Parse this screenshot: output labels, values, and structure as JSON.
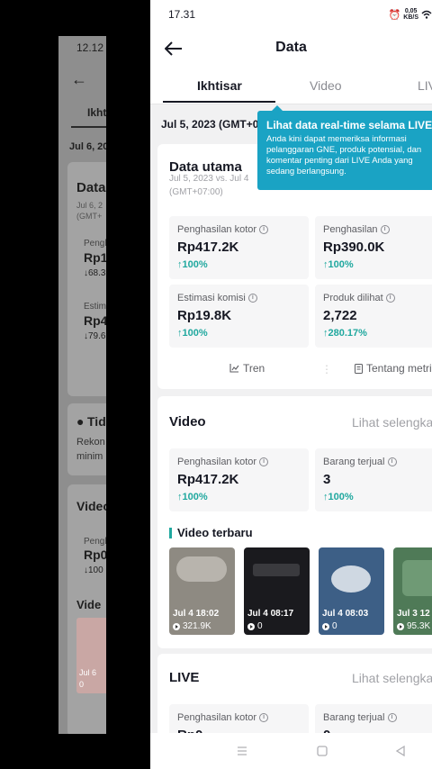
{
  "background_screen": {
    "time": "12.12",
    "tab": "Ikht",
    "date": "Jul 6, 20",
    "card_title": "Data",
    "card_sub_1": "Jul 6, 2",
    "card_sub_2": "(GMT+",
    "metric1_label": "Pengh",
    "metric1_value": "Rp1",
    "metric1_change": "↓68.3",
    "metric2_label": "Estim",
    "metric2_value": "Rp4",
    "metric2_change": "↓79.6",
    "tips_title": "Tid",
    "tips_line1": "Rekon",
    "tips_line2": "minim",
    "video_title": "Video",
    "video_metric_label": "Pengh",
    "video_metric_value": "Rp0",
    "video_metric_change": "↓100",
    "latest_label": "Vide",
    "thumb_text": "Jul 6",
    "thumb_views": "0"
  },
  "status_bar": {
    "time": "17.31",
    "speed_top": "0,05",
    "speed_bottom": "KB/S"
  },
  "header": {
    "title": "Data"
  },
  "tabs": [
    {
      "label": "Ikhtisar",
      "active": true
    },
    {
      "label": "Video",
      "active": false
    },
    {
      "label": "LIVE",
      "active": false
    }
  ],
  "date_range": "Jul 5, 2023 (GMT+0",
  "tooltip": {
    "title": "Lihat data real-time selama LIVE",
    "lines": [
      "Anda kini dapat memeriksa informasi",
      "pelanggaran GNE, produk potensial, dan",
      "komentar penting dari LIVE Anda yang",
      "sedang berlangsung."
    ]
  },
  "main_data": {
    "title": "Data utama",
    "comparison_line1": "Jul 5, 2023 vs. Jul 4",
    "comparison_line2": "(GMT+07:00)",
    "metrics": [
      {
        "label": "Penghasilan kotor",
        "value": "Rp417.2K",
        "change": "100%"
      },
      {
        "label": "Penghasilan",
        "value": "Rp390.0K",
        "change": "100%"
      },
      {
        "label": "Estimasi komisi",
        "value": "Rp19.8K",
        "change": "100%"
      },
      {
        "label": "Produk dilihat",
        "value": "2,722",
        "change": "280.17%"
      }
    ],
    "trend_label": "Tren",
    "about_label": "Tentang metrik"
  },
  "video_section": {
    "title": "Video",
    "see_all": "Lihat selengkapnya",
    "metrics": [
      {
        "label": "Penghasilan kotor",
        "value": "Rp417.2K",
        "change": "100%"
      },
      {
        "label": "Barang terjual",
        "value": "3",
        "change": "100%"
      }
    ],
    "latest_title": "Video terbaru",
    "thumbnails": [
      {
        "date": "Jul 4 18:02",
        "views": "321.9K",
        "color": "#8e8a82"
      },
      {
        "date": "Jul 4 08:17",
        "views": "0",
        "color": "#1a1a1e"
      },
      {
        "date": "Jul 4 08:03",
        "views": "0",
        "color": "#3d5f86"
      },
      {
        "date": "Jul 3 12",
        "views": "95.3K",
        "color": "#4f7a57"
      }
    ]
  },
  "live_section": {
    "title": "LIVE",
    "see_all": "Lihat selengkapnya",
    "metrics": [
      {
        "label": "Penghasilan kotor",
        "value": "Rp0",
        "change": ""
      },
      {
        "label": "Barang terjual",
        "value": "0",
        "change": ""
      }
    ]
  },
  "colors": {
    "accent_teal": "#20a89f",
    "tooltip_blue": "#1aa3c4",
    "negative_red": "#fe2c55"
  }
}
